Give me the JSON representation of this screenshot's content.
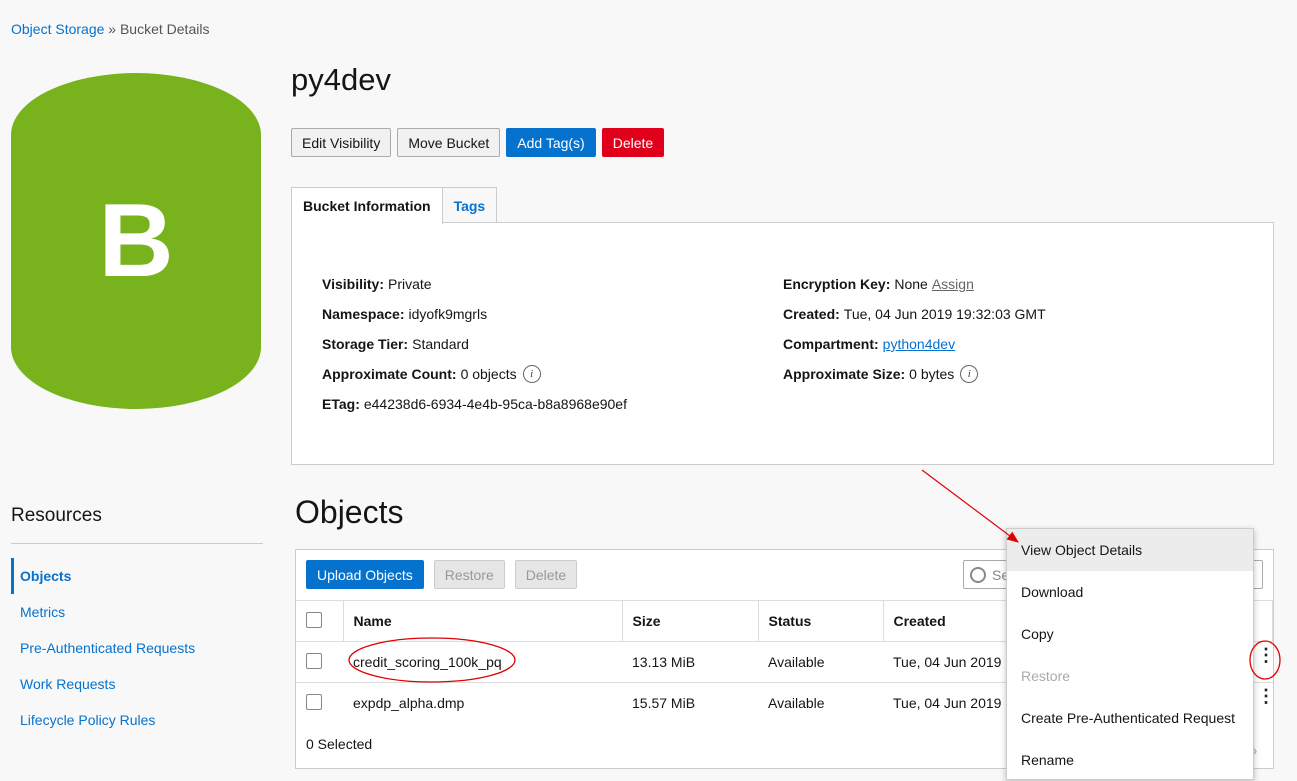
{
  "breadcrumb": {
    "root": "Object Storage",
    "sep": "»",
    "current": "Bucket Details"
  },
  "bucket": {
    "icon_letter": "B",
    "name": "py4dev",
    "actions": [
      "Edit Visibility",
      "Move Bucket",
      "Add Tag(s)",
      "Delete"
    ],
    "tabs": [
      "Bucket Information",
      "Tags"
    ],
    "info": {
      "visibility_label": "Visibility:",
      "visibility": "Private",
      "namespace_label": "Namespace:",
      "namespace": "idyofk9mgrls",
      "storage_tier_label": "Storage Tier:",
      "storage_tier": "Standard",
      "approx_count_label": "Approximate Count:",
      "approx_count": "0 objects",
      "etag_label": "ETag:",
      "etag": "e44238d6-6934-4e4b-95ca-b8a8968e90ef",
      "encryption_label": "Encryption Key:",
      "encryption": "None",
      "encryption_link": "Assign",
      "created_label": "Created:",
      "created": "Tue, 04 Jun 2019 19:32:03 GMT",
      "compartment_label": "Compartment:",
      "compartment": "python4dev",
      "approx_size_label": "Approximate Size:",
      "approx_size": "0 bytes",
      "info_glyph": "i"
    }
  },
  "resources": {
    "title": "Resources",
    "items": [
      "Objects",
      "Metrics",
      "Pre-Authenticated Requests",
      "Work Requests",
      "Lifecycle Policy Rules"
    ],
    "active": "Objects"
  },
  "objects": {
    "title": "Objects",
    "actions": {
      "upload": "Upload Objects",
      "restore": "Restore",
      "delete": "Delete"
    },
    "search_placeholder": "Se",
    "columns": [
      "Name",
      "Size",
      "Status",
      "Created"
    ],
    "rows": [
      {
        "name": "credit_scoring_100k_pq",
        "size": "13.13 MiB",
        "status": "Available",
        "created": "Tue, 04 Jun 2019"
      },
      {
        "name": "expdp_alpha.dmp",
        "size": "15.57 MiB",
        "status": "Available",
        "created": "Tue, 04 Jun 2019"
      }
    ],
    "footer": "0 Selected",
    "kebab_glyph": "⋮"
  },
  "context_menu": {
    "items": [
      "View Object Details",
      "Download",
      "Copy",
      "Restore",
      "Create Pre-Authenticated Request",
      "Rename"
    ]
  },
  "colors": {
    "brand_green": "#78b21c",
    "link_blue": "#0572ce",
    "danger_red": "#e0001b",
    "annotation_red": "#e00000"
  }
}
